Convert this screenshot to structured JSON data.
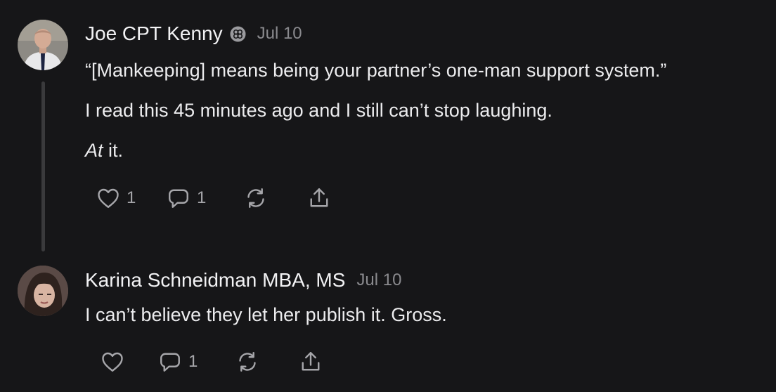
{
  "comments": [
    {
      "author": "Joe CPT Kenny",
      "date": "Jul 10",
      "badge_icon": "badge-icon",
      "paragraphs": [
        "“[Mankeeping] means being your partner’s one-man support system.”",
        "I read this 45 minutes ago and I still can’t stop laughing."
      ],
      "last_line_italic": "At",
      "last_line_rest": " it.",
      "likes": "1",
      "replies": "1"
    },
    {
      "author": "Karina Schneidman MBA, MS",
      "date": "Jul 10",
      "paragraphs": [
        "I can’t believe they let her publish it. Gross."
      ],
      "likes": "",
      "replies": "1"
    }
  ],
  "icons": [
    "heart-icon",
    "comment-icon",
    "restack-icon",
    "share-icon"
  ],
  "colors": {
    "background": "#161618",
    "text": "#ececee",
    "muted": "#8a8a8e",
    "icon": "#a6a6aa",
    "thread_line": "#3a3a3c"
  }
}
